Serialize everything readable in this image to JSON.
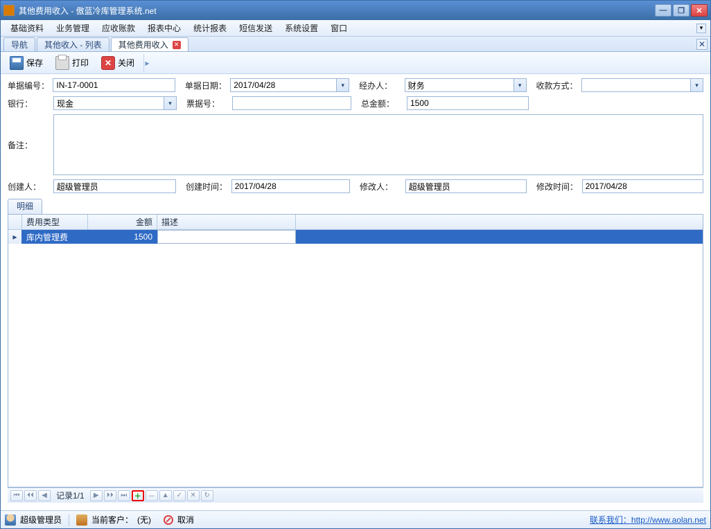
{
  "title": "其他费用收入 - 傲蓝冷库管理系统.net",
  "menu": [
    "基础资料",
    "业务管理",
    "应收账款",
    "报表中心",
    "统计报表",
    "短信发送",
    "系统设置",
    "窗口"
  ],
  "tabs": [
    {
      "label": "导航",
      "active": false,
      "closable": false
    },
    {
      "label": "其他收入 - 列表",
      "active": false,
      "closable": false
    },
    {
      "label": "其他费用收入",
      "active": true,
      "closable": true
    }
  ],
  "toolbar": {
    "save": "保存",
    "print": "打印",
    "close": "关闭"
  },
  "form": {
    "doc_no_label": "单据编号：",
    "doc_no": "IN-17-0001",
    "doc_date_label": "单据日期：",
    "doc_date": "2017/04/28",
    "handler_label": "经办人：",
    "handler": "财务",
    "receipt_mode_label": "收款方式：",
    "receipt_mode": "",
    "bank_label": "银行：",
    "bank": "现金",
    "voucher_label": "票据号：",
    "voucher": "",
    "total_label": "总金额：",
    "total": "1500",
    "remarks_label": "备注：",
    "remarks": "",
    "creator_label": "创建人：",
    "creator": "超级管理员",
    "create_time_label": "创建时间：",
    "create_time": "2017/04/28",
    "modifier_label": "修改人：",
    "modifier": "超级管理员",
    "modify_time_label": "修改时间：",
    "modify_time": "2017/04/28"
  },
  "detail_tab": "明细",
  "grid": {
    "columns": [
      "费用类型",
      "金额",
      "描述"
    ],
    "rows": [
      {
        "type": "库内管理费",
        "amount": "1500",
        "desc": ""
      }
    ]
  },
  "nav": {
    "record": "记录1/1"
  },
  "status": {
    "user": "超级管理员",
    "client_label": "当前客户：",
    "client_value": "(无)",
    "cancel": "取消",
    "contact": "联系我们：http://www.aolan.net"
  }
}
